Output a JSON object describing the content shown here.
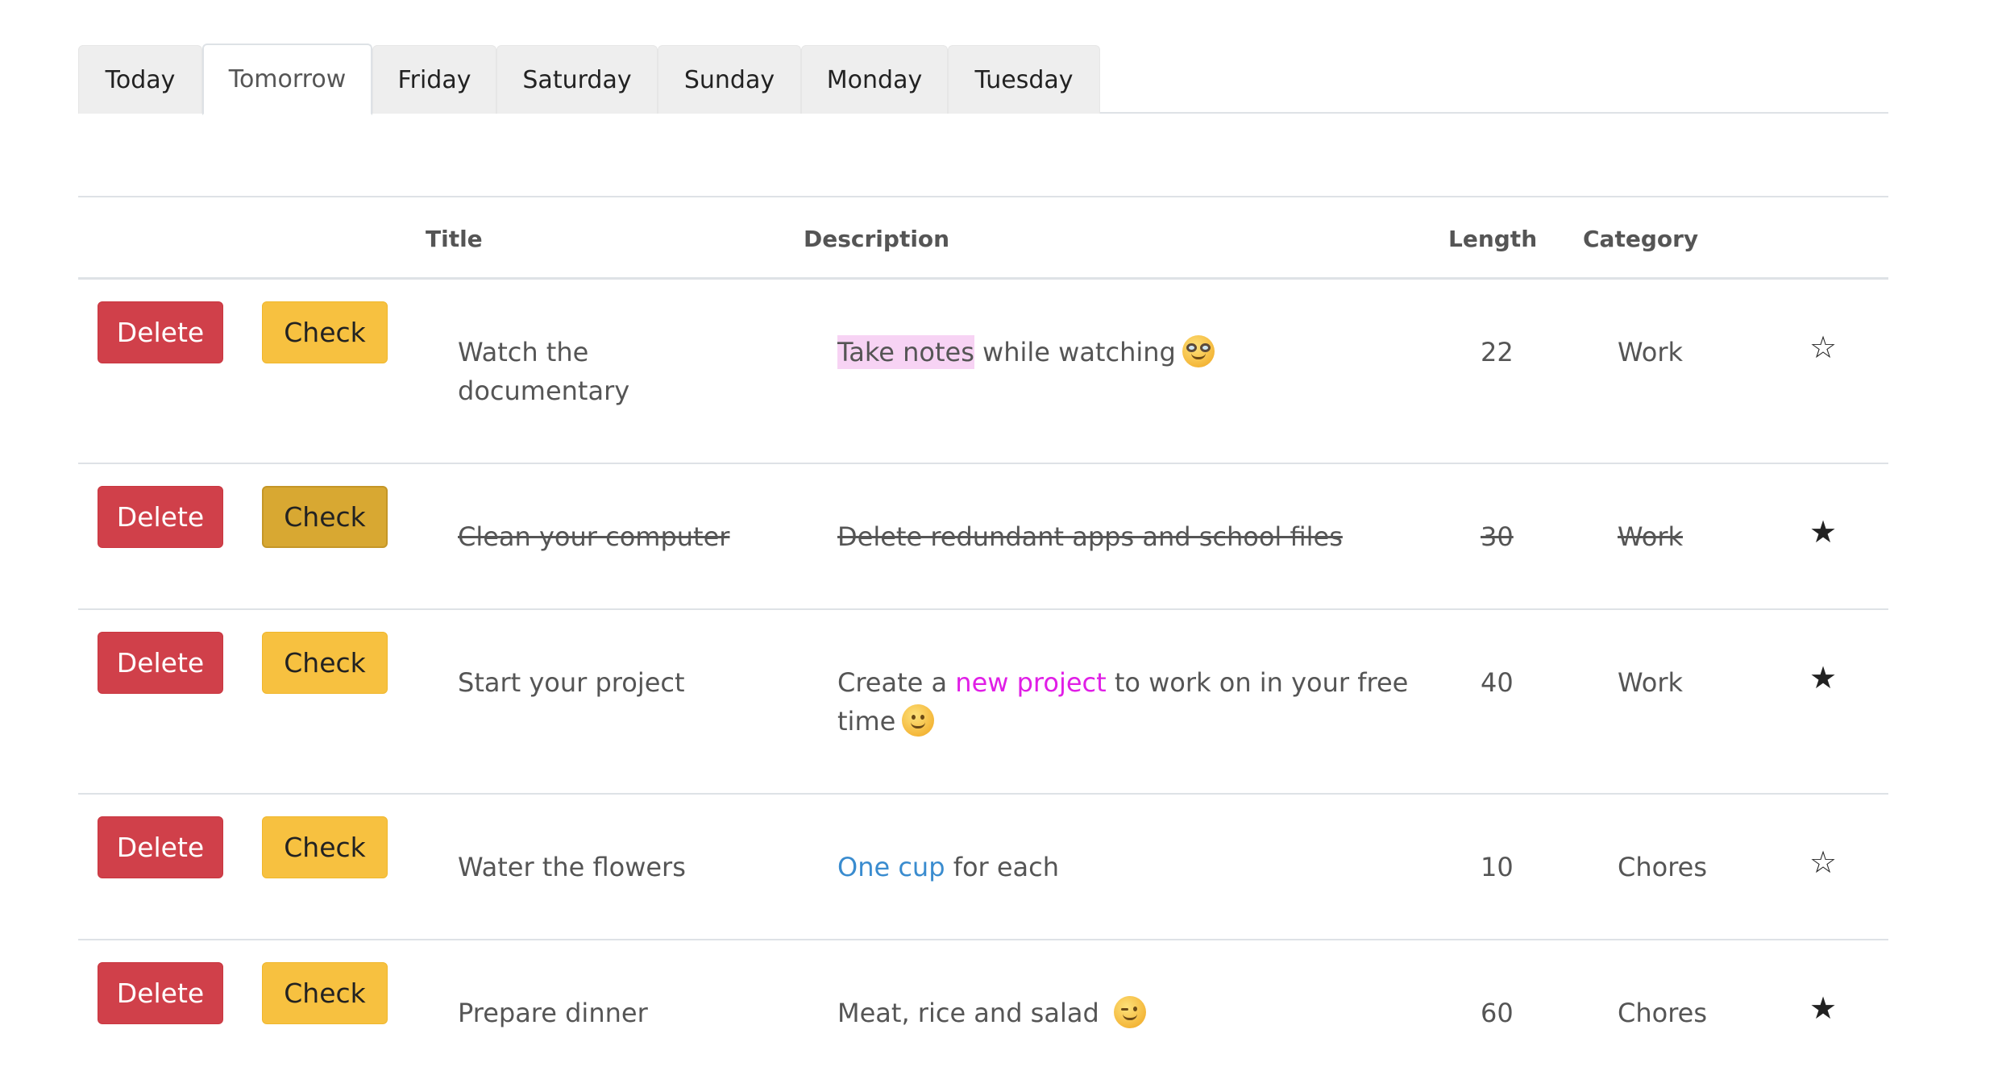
{
  "tabs": [
    {
      "label": "Today",
      "active": false
    },
    {
      "label": "Tomorrow",
      "active": true
    },
    {
      "label": "Friday",
      "active": false
    },
    {
      "label": "Saturday",
      "active": false
    },
    {
      "label": "Sunday",
      "active": false
    },
    {
      "label": "Monday",
      "active": false
    },
    {
      "label": "Tuesday",
      "active": false
    }
  ],
  "table": {
    "headers": {
      "title": "Title",
      "description": "Description",
      "length": "Length",
      "category": "Category"
    },
    "delete_label": "Delete",
    "check_label": "Check",
    "rows": [
      {
        "title_line1": "Watch the",
        "title_line2": "documentary",
        "desc_highlight": "Take notes",
        "desc_rest": " while watching",
        "emoji": "nerd-face-icon",
        "length": "22",
        "category": "Work",
        "starred": false,
        "done": false
      },
      {
        "title": "Clean your computer",
        "description": "Delete redundant apps and school files",
        "length": "30",
        "category": "Work",
        "starred": true,
        "done": true
      },
      {
        "desc_pre": "Create a ",
        "desc_link": "new project",
        "desc_post": " to work on in your free",
        "desc_line2": "time",
        "emoji": "slightly-smiling-face-icon",
        "title": "Start your project",
        "length": "40",
        "category": "Work",
        "starred": true,
        "done": false
      },
      {
        "title": "Water the flowers",
        "desc_link": "One cup",
        "desc_post": " for each",
        "length": "10",
        "category": "Chores",
        "starred": false,
        "done": false
      },
      {
        "title": "Prepare dinner",
        "description": "Meat, rice and salad",
        "emoji": "winking-face-icon",
        "length": "60",
        "category": "Chores",
        "starred": true,
        "done": false
      }
    ]
  },
  "colors": {
    "delete": "#d0404a",
    "check": "#f7c140",
    "highlight_pink": "#f7d3f4",
    "magenta_text": "#e01ee6",
    "blue_text": "#3a8ccf"
  }
}
